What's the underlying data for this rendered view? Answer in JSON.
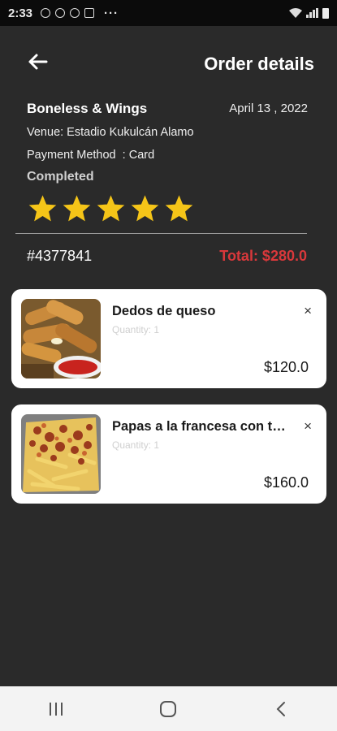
{
  "status_bar": {
    "time": "2:33",
    "more": "···"
  },
  "header": {
    "title": "Order details",
    "back_icon": "arrow-left-icon"
  },
  "order": {
    "restaurant": "Boneless & Wings",
    "date": "April 13 , 2022",
    "venue": "Venue: Estadio Kukulcán Alamo",
    "payment": "Payment Method  : Card",
    "status": "Completed",
    "rating": 5,
    "rating_max": 5,
    "number": "#4377841",
    "total": "Total: $280.0"
  },
  "items": [
    {
      "name": "Dedos de queso",
      "quantity": "Quantity: 1",
      "price": "$120.0",
      "remove": "×"
    },
    {
      "name": "Papas a la francesa con tocino",
      "quantity": "Quantity: 1",
      "price": "$160.0",
      "remove": "×"
    }
  ],
  "colors": {
    "background": "#2a2a2a",
    "star": "#f5c518",
    "total": "#d9383b",
    "card": "#ffffff"
  }
}
